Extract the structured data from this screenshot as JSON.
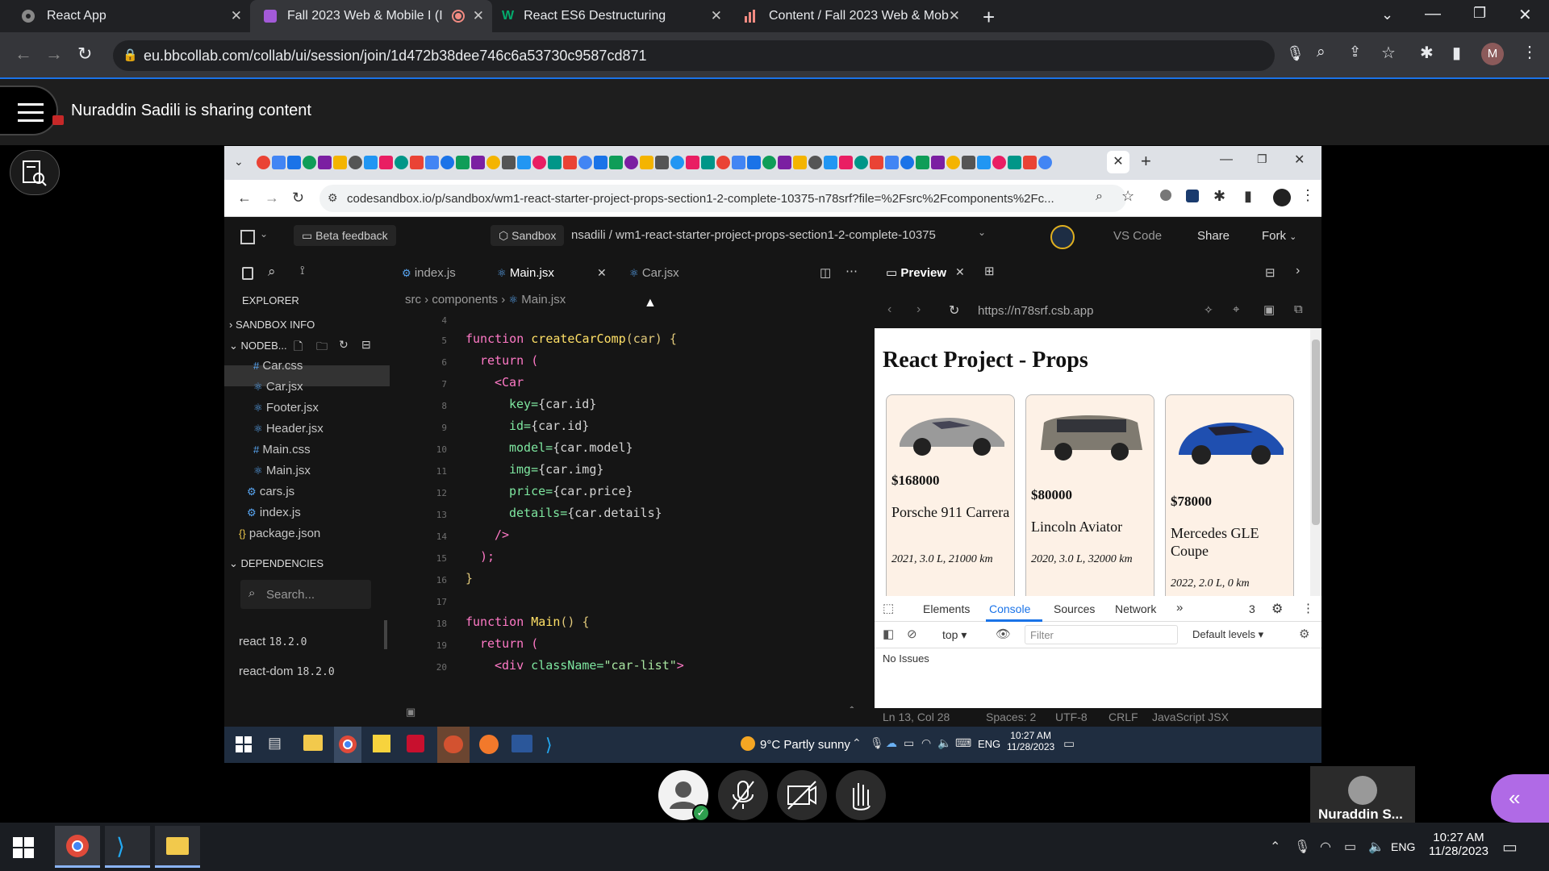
{
  "outer_tabs": [
    {
      "label": "React App"
    },
    {
      "label": "Fall 2023 Web & Mobile I (I"
    },
    {
      "label": "React ES6 Destructuring"
    },
    {
      "label": "Content / Fall 2023 Web & Mob"
    }
  ],
  "outer_url": "eu.bbcollab.com/collab/ui/session/join/1d472b38dee746c6a53730c9587cd871",
  "profile_initial": "M",
  "collab": {
    "sharing_text": "Nuraddin Sadili is sharing content"
  },
  "inner_url": "codesandbox.io/p/sandbox/wm1-react-starter-project-props-section1-2-complete-10375-n78srf?file=%2Fsrc%2Fcomponents%2Fc...",
  "sandbox": {
    "beta_feedback": "Beta feedback",
    "sandbox_badge": "Sandbox",
    "path": "nsadili / wm1-react-starter-project-props-section1-2-complete-10375",
    "vscode": "VS Code",
    "share": "Share",
    "fork": "Fork"
  },
  "explorer": {
    "title": "EXPLORER",
    "sandbox_info": "SANDBOX INFO",
    "nodebox": "NODEB...",
    "files": [
      "Car.css",
      "Car.jsx",
      "Footer.jsx",
      "Header.jsx",
      "Main.css",
      "Main.jsx",
      "cars.js",
      "index.js",
      "package.json"
    ],
    "dependencies": "DEPENDENCIES",
    "search_placeholder": "Search...",
    "deps": [
      {
        "name": "react",
        "version": "18.2.0"
      },
      {
        "name": "react-dom",
        "version": "18.2.0"
      }
    ]
  },
  "editor_tabs": [
    "index.js",
    "Main.jsx",
    "Car.jsx"
  ],
  "breadcrumb": {
    "a": "src",
    "b": "components",
    "c": "Main.jsx"
  },
  "line_numbers": [
    "4",
    "5",
    "6",
    "7",
    "8",
    "9",
    "10",
    "11",
    "12",
    "13",
    "14",
    "15",
    "16",
    "17",
    "18",
    "19",
    "20"
  ],
  "code": {
    "l5_kw": "function ",
    "l5_fn": "createCarComp",
    "l5_rest": "(car) {",
    "l6": "return (",
    "l7": "<Car",
    "l8a": "key=",
    "l8b": "{car.id}",
    "l9a": "id=",
    "l9b": "{car.id}",
    "l10a": "model=",
    "l10b": "{car.model}",
    "l11a": "img=",
    "l11b": "{car.img}",
    "l12a": "price=",
    "l12b": "{car.price}",
    "l13a": "details=",
    "l13b": "{car.details}",
    "l14": "/>",
    "l15": ");",
    "l16": "}",
    "l18_kw": "function ",
    "l18_fn": "Main",
    "l18_rest": "() {",
    "l19": "return (",
    "l20a": "<div ",
    "l20b": "className=",
    "l20c": "\"car-list\"",
    "l20d": ">"
  },
  "preview": {
    "tab": "Preview",
    "url": "https://n78srf.csb.app",
    "heading": "React Project - Props",
    "cars": [
      {
        "price": "$168000",
        "model": "Porsche 911 Carrera",
        "details": "2021, 3.0 L, 21000 km",
        "color": "#9a9a9a"
      },
      {
        "price": "$80000",
        "model": "Lincoln Aviator",
        "details": "2020, 3.0 L, 32000 km",
        "color": "#7f7a70"
      },
      {
        "price": "$78000",
        "model": "Mercedes GLE Coupe",
        "details": "2022, 2.0 L, 0 km",
        "color": "#1f4fb0"
      }
    ]
  },
  "devtools": {
    "tabs": [
      "Elements",
      "Console",
      "Sources",
      "Network"
    ],
    "count": "3",
    "context": "top",
    "filter_placeholder": "Filter",
    "levels": "Default levels",
    "no_issues": "No Issues"
  },
  "statusbar": {
    "pos": "Ln 13, Col 28",
    "spaces": "Spaces: 2",
    "enc": "UTF-8",
    "eol": "CRLF",
    "lang": "JavaScript JSX"
  },
  "inner_taskbar": {
    "weather": "9°C  Partly sunny",
    "lang": "ENG",
    "time": "10:27 AM",
    "date": "11/28/2023"
  },
  "participant": {
    "name": "Nuraddin S..."
  },
  "win_taskbar": {
    "lang": "ENG",
    "time": "10:27 AM",
    "date": "11/28/2023"
  }
}
